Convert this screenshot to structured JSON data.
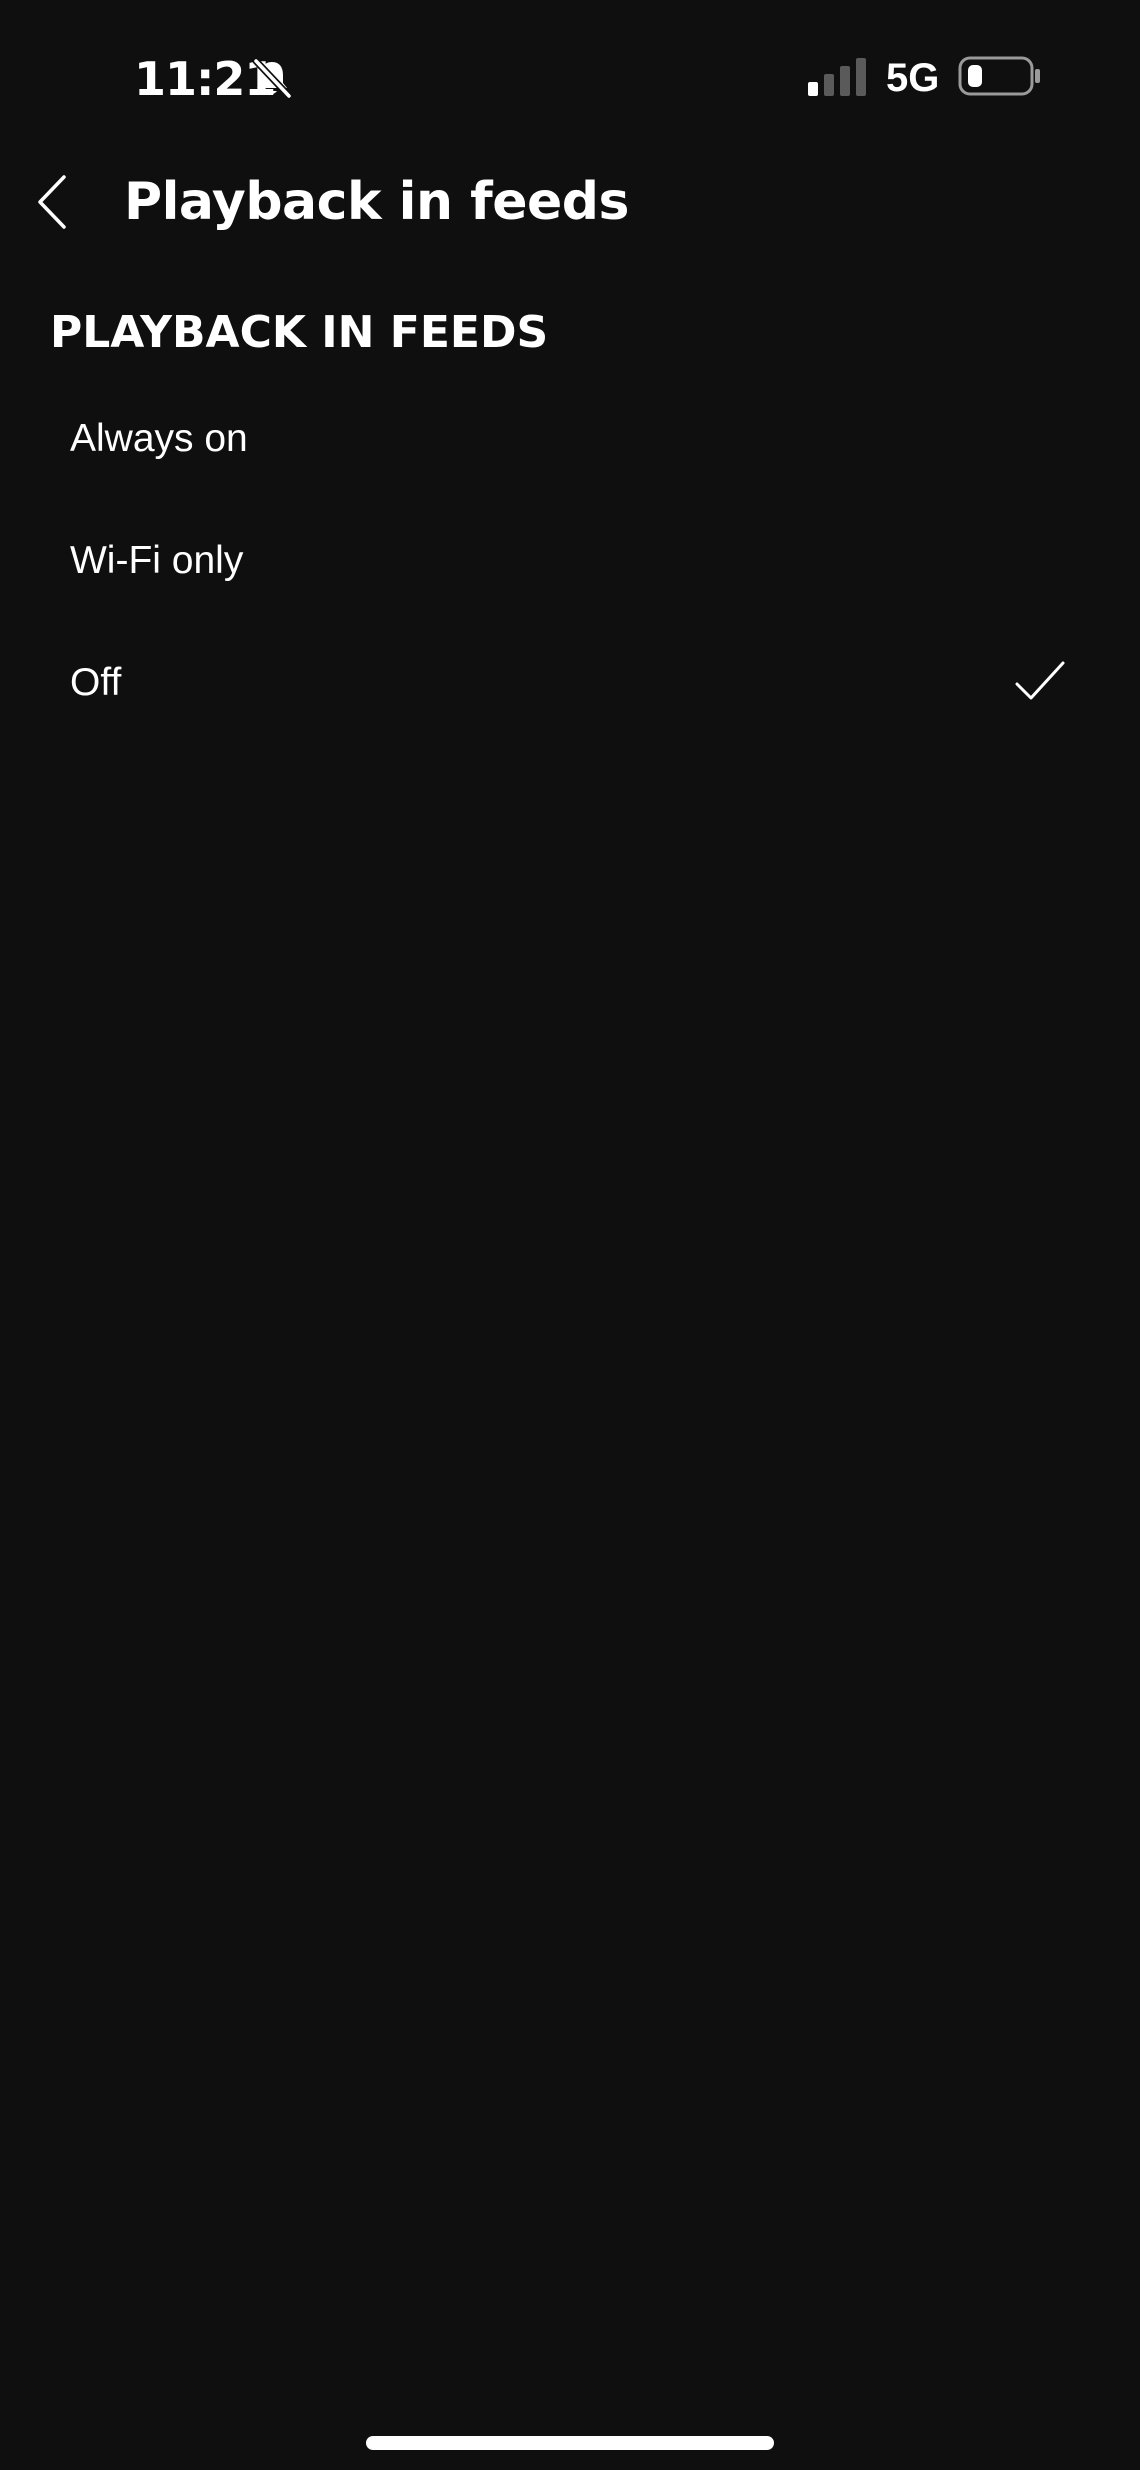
{
  "status_bar": {
    "time": "11:21",
    "network": "5G",
    "icons": [
      "bell-slash-icon",
      "signal-icon",
      "battery-icon"
    ]
  },
  "header": {
    "back_icon": "chevron-left-icon",
    "title": "Playback in feeds"
  },
  "section": {
    "title": "PLAYBACK IN FEEDS",
    "options": [
      {
        "label": "Always on",
        "selected": false
      },
      {
        "label": "Wi-Fi only",
        "selected": false
      },
      {
        "label": "Off",
        "selected": true
      }
    ]
  },
  "colors": {
    "background": "#0f0f0f",
    "text": "#ffffff",
    "inactive_signal": "#5a5a5a"
  }
}
